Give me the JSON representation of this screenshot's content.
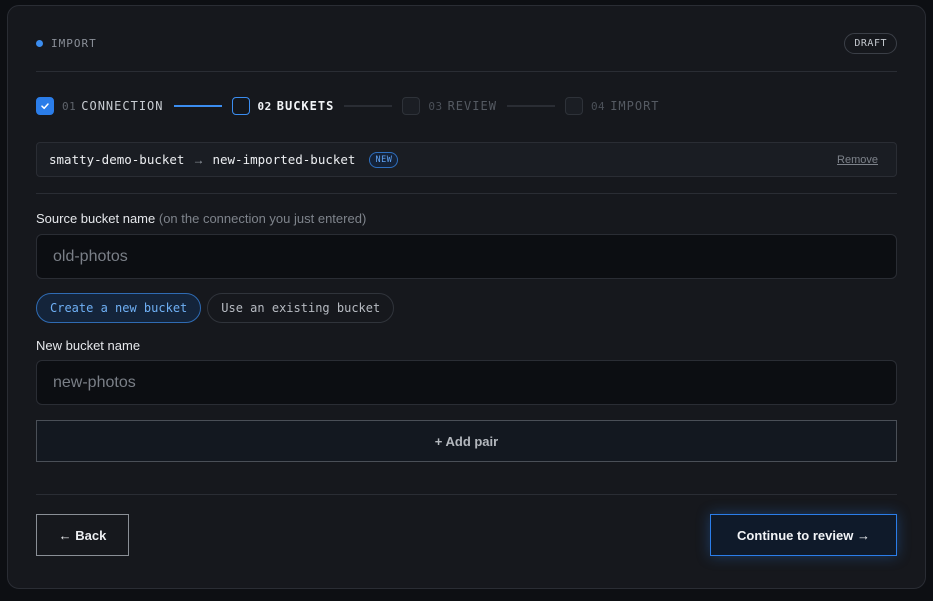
{
  "header": {
    "label": "IMPORT",
    "status_badge": "DRAFT"
  },
  "steps": [
    {
      "num": "01",
      "name": "CONNECTION",
      "state": "done"
    },
    {
      "num": "02",
      "name": "BUCKETS",
      "state": "active"
    },
    {
      "num": "03",
      "name": "REVIEW",
      "state": "todo"
    },
    {
      "num": "04",
      "name": "IMPORT",
      "state": "todo"
    }
  ],
  "pair": {
    "source": "smatty-demo-bucket",
    "arrow": "→",
    "target": "new-imported-bucket",
    "badge": "NEW",
    "remove_label": "Remove"
  },
  "source_field": {
    "label": "Source bucket name",
    "hint": "(on the connection you just entered)",
    "placeholder": "old-photos"
  },
  "bucket_mode": {
    "options": [
      "Create a new bucket",
      "Use an existing bucket"
    ],
    "selected": "Create a new bucket"
  },
  "new_bucket_field": {
    "label": "New bucket name",
    "placeholder": "new-photos"
  },
  "add_pair_label": "+ Add pair",
  "footer": {
    "back_label": "← Back",
    "continue_label": "Continue to review →"
  },
  "colors": {
    "accent": "#2b7de9",
    "background": "#16181d"
  }
}
